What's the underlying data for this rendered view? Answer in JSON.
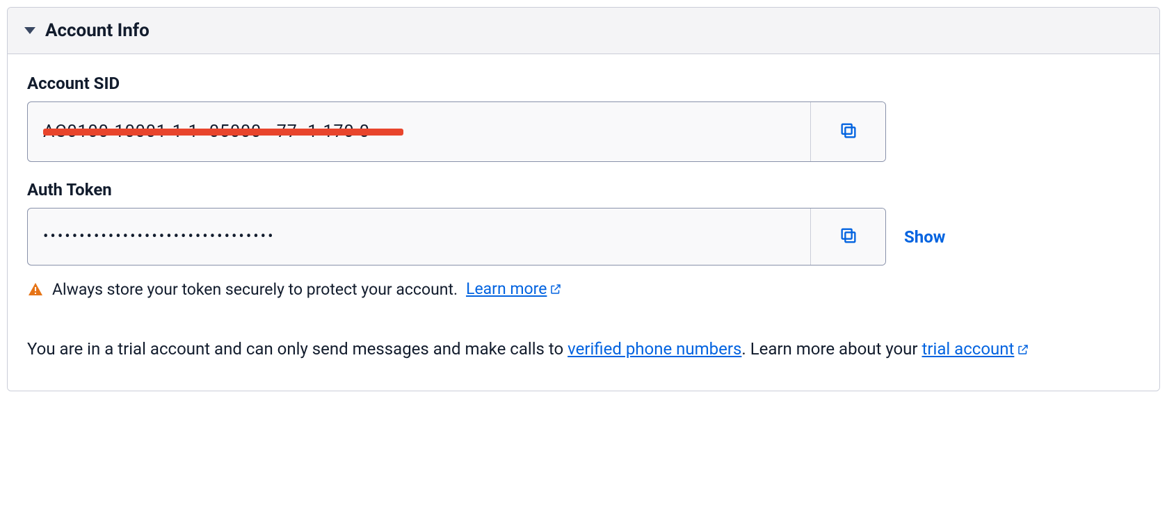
{
  "panel": {
    "title": "Account Info"
  },
  "account_sid": {
    "label": "Account SID",
    "value": "AC0100-10001-1-1- 05000   77  1 170 0"
  },
  "auth_token": {
    "label": "Auth Token",
    "masked_value": "••••••••••••••••••••••••••••••••",
    "show_label": "Show"
  },
  "warning": {
    "text": "Always store your token securely to protect your account.",
    "learn_more": "Learn more"
  },
  "trial": {
    "prefix": "You are in a trial account and can only send messages and make calls to ",
    "verified_link": "verified phone numbers",
    "middle": ". Learn more about your ",
    "trial_link": "trial account"
  }
}
